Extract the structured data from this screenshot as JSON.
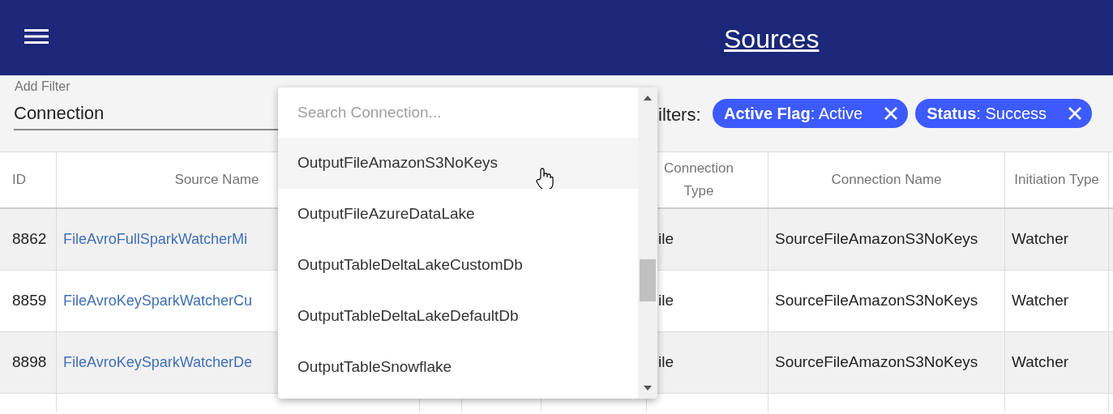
{
  "header": {
    "title": "Sources"
  },
  "filter": {
    "label": "Add Filter",
    "value": "Connection",
    "active_filters_label": "ilters:",
    "chips": [
      {
        "text": "**Active Flag**: Active"
      },
      {
        "text": "**Status**: Success"
      }
    ]
  },
  "table": {
    "columns": [
      "ID",
      "Source Name",
      "Connection Type",
      "Connection Name",
      "Initiation Type"
    ],
    "rows": [
      {
        "cells": [
          "8862",
          "FileAvroFullSparkWatcherMi",
          "ile",
          "SourceFileAmazonS3NoKeys",
          "Watcher"
        ]
      },
      {
        "cells": [
          "8859",
          "FileAvroKeySparkWatcherCu",
          "ile",
          "SourceFileAmazonS3NoKeys",
          "Watcher"
        ]
      },
      {
        "cells": [
          "8898",
          "FileAvroKeySparkWatcherDe",
          "ile",
          "SourceFileAmazonS3NoKeys",
          "Watcher"
        ]
      }
    ]
  },
  "dropdown": {
    "placeholder": "Search Connection...",
    "options": [
      {
        "label": "OutputFileAmazonS3NoKeys",
        "highlighted": true
      },
      {
        "label": "OutputFileAzureDataLake",
        "highlighted": false
      },
      {
        "label": "OutputTableDeltaLakeCustomDb",
        "highlighted": false
      },
      {
        "label": "OutputTableDeltaLakeDefaultDb",
        "highlighted": false
      },
      {
        "label": "OutputTableSnowflake",
        "highlighted": false
      }
    ]
  }
}
